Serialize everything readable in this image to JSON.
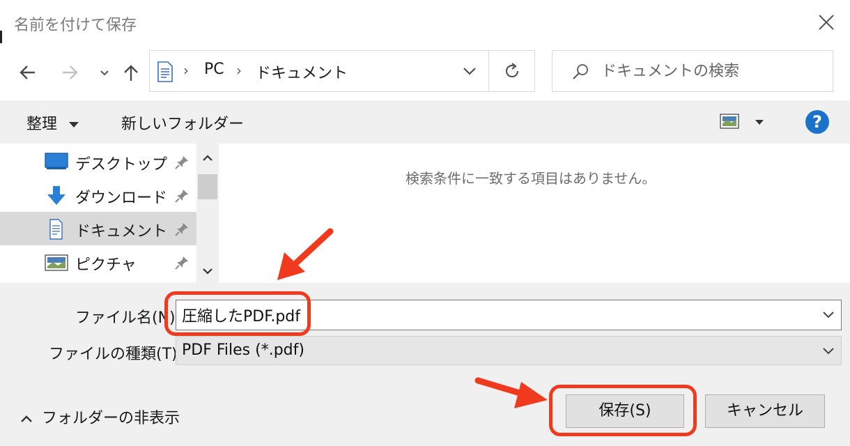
{
  "dialog": {
    "title": "名前を付けて保存"
  },
  "navigation": {
    "breadcrumb": [
      "PC",
      "ドキュメント"
    ],
    "search_placeholder": "ドキュメントの検索"
  },
  "toolbar": {
    "organize_label": "整理",
    "new_folder_label": "新しいフォルダー"
  },
  "sidebar": {
    "items": [
      {
        "label": "デスクトップ",
        "icon": "desktop-icon",
        "selected": false
      },
      {
        "label": "ダウンロード",
        "icon": "download-icon",
        "selected": false
      },
      {
        "label": "ドキュメント",
        "icon": "document-icon",
        "selected": true
      },
      {
        "label": "ピクチャ",
        "icon": "pictures-icon",
        "selected": false
      }
    ]
  },
  "content": {
    "empty_message": "検索条件に一致する項目はありません。"
  },
  "form": {
    "filename_label": "ファイル名(N):",
    "filename_value": "圧縮したPDF.pdf",
    "filetype_label": "ファイルの種類(T):",
    "filetype_value": "PDF Files (*.pdf)"
  },
  "footer": {
    "hide_folders_label": "フォルダーの非表示",
    "save_label": "保存(S)",
    "cancel_label": "キャンセル"
  },
  "colors": {
    "highlight": "#f03a1e",
    "help_blue": "#1a73c9",
    "selected_bg": "#d9d9d9",
    "panel_bg": "#f0f0f0"
  }
}
